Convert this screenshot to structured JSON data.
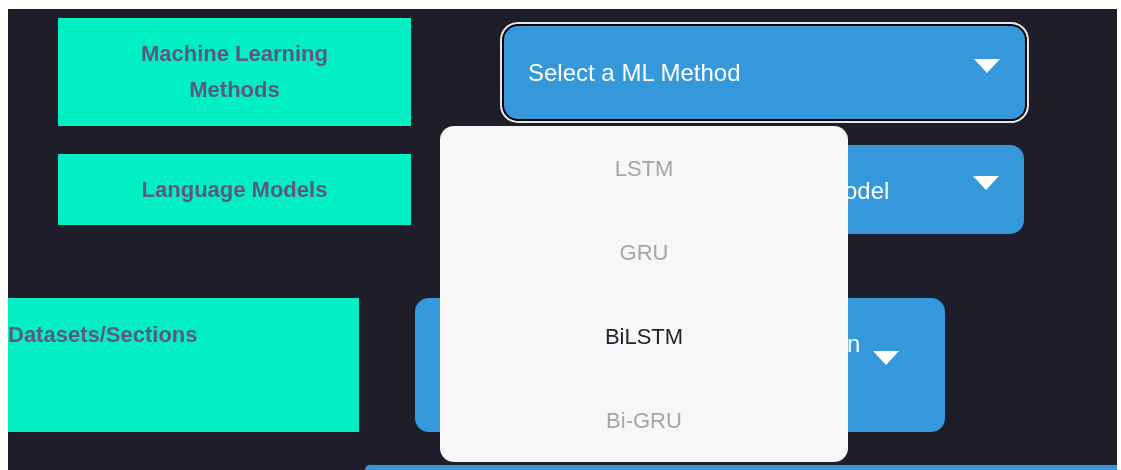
{
  "fields": [
    {
      "label": "Machine Learning Methods",
      "dropdown": {
        "value": "Select a ML Method",
        "focused": true
      }
    },
    {
      "label": "Language Models",
      "dropdown": {
        "value": "odel",
        "focused": false
      }
    },
    {
      "label": "Datasets/Sections",
      "dropdown": {
        "value": "n",
        "focused": false
      }
    }
  ],
  "menu": {
    "items": [
      {
        "label": "LSTM",
        "disabled": true
      },
      {
        "label": "GRU",
        "disabled": true
      },
      {
        "label": "BiLSTM",
        "disabled": false
      },
      {
        "label": "Bi-GRU",
        "disabled": true
      }
    ]
  }
}
